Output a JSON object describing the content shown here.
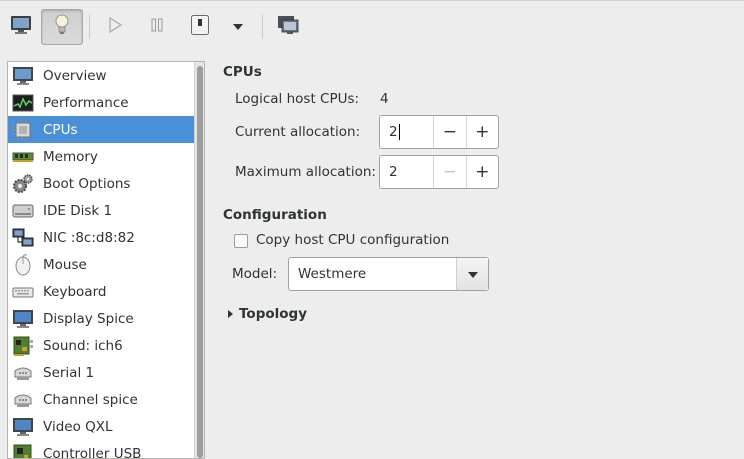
{
  "toolbar": {
    "buttons": [
      {
        "name": "console",
        "icon": "monitor-icon"
      },
      {
        "name": "details",
        "icon": "lightbulb-icon",
        "active": true
      },
      {
        "name": "run",
        "icon": "play-icon"
      },
      {
        "name": "pause",
        "icon": "pause-icon"
      },
      {
        "name": "shutdown",
        "icon": "power-icon"
      },
      {
        "name": "shutdown-menu",
        "icon": "chevron-down-icon"
      },
      {
        "name": "fullscreen",
        "icon": "screens-icon"
      }
    ]
  },
  "sidebar": {
    "selected_index": 2,
    "items": [
      {
        "label": "Overview",
        "icon": "monitor-icon"
      },
      {
        "label": "Performance",
        "icon": "performance-graph-icon"
      },
      {
        "label": "CPUs",
        "icon": "cpu-chip-icon"
      },
      {
        "label": "Memory",
        "icon": "memory-module-icon"
      },
      {
        "label": "Boot Options",
        "icon": "gears-icon"
      },
      {
        "label": "IDE Disk 1",
        "icon": "hard-disk-icon"
      },
      {
        "label": "NIC :8c:d8:82",
        "icon": "network-icon"
      },
      {
        "label": "Mouse",
        "icon": "mouse-icon"
      },
      {
        "label": "Keyboard",
        "icon": "keyboard-icon"
      },
      {
        "label": "Display Spice",
        "icon": "display-icon"
      },
      {
        "label": "Sound: ich6",
        "icon": "sound-card-icon"
      },
      {
        "label": "Serial 1",
        "icon": "serial-port-icon"
      },
      {
        "label": "Channel spice",
        "icon": "channel-icon"
      },
      {
        "label": "Video QXL",
        "icon": "video-icon"
      },
      {
        "label": "Controller USB",
        "icon": "controller-card-icon"
      }
    ]
  },
  "cpus": {
    "title": "CPUs",
    "logical_label": "Logical host CPUs:",
    "logical_value": "4",
    "current_label": "Current allocation:",
    "current_value": "2",
    "maximum_label": "Maximum allocation:",
    "maximum_value": "2",
    "minus": "−",
    "plus": "+"
  },
  "configuration": {
    "title": "Configuration",
    "copy_label": "Copy host CPU configuration",
    "copy_checked": false,
    "model_label": "Model:",
    "model_value": "Westmere"
  },
  "topology": {
    "label": "Topology",
    "expanded": false
  },
  "colors": {
    "selection": "#4a90d9",
    "window_bg": "#ededed"
  }
}
